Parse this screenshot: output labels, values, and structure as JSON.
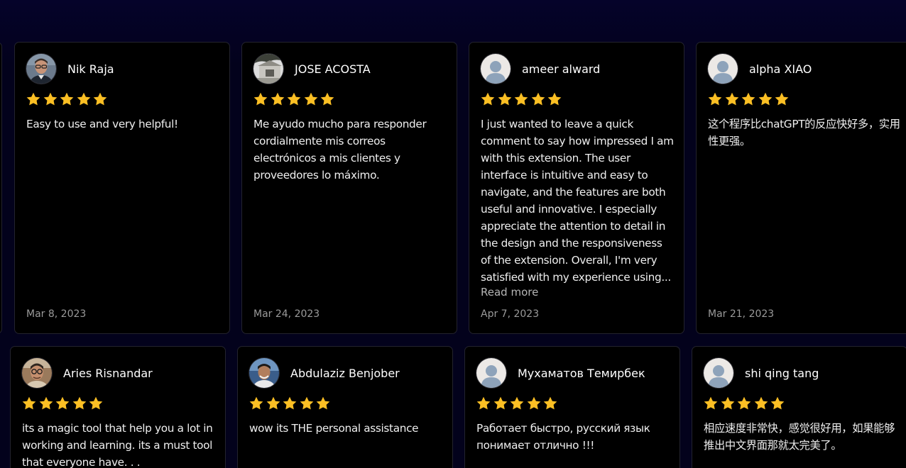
{
  "colors": {
    "background": "#03021c",
    "card": "#000000",
    "star": "#fbbf24",
    "text": "#eeeeee",
    "muted": "#9a9a9a"
  },
  "reviews": [
    {
      "name": "Nik Raja",
      "rating": 5,
      "text": "Easy to use and very helpful!",
      "date": "Mar 8, 2023",
      "avatar": "photo-man-glasses"
    },
    {
      "name": "JOSE ACOSTA",
      "rating": 5,
      "text": "Me ayudo mucho para responder cordialmente mis correos electrónicos a mis clientes y proveedores lo máximo.",
      "date": "Mar 24, 2023",
      "avatar": "photo-building"
    },
    {
      "name": "ameer alward",
      "rating": 5,
      "text": "I just wanted to leave a quick comment to say how impressed I am with this extension. The user interface is intuitive and easy to navigate, and the features are both useful and innovative. I especially appreciate the attention to detail in the design and the responsiveness of the extension. Overall, I'm very satisfied with my experience using...",
      "read_more": "Read more",
      "date": "Apr 7, 2023",
      "avatar": "default-user-avatar"
    },
    {
      "name": "alpha XIAO",
      "rating": 5,
      "text": "这个程序比chatGPT的反应快好多，实用性更强。",
      "date": "Mar 21, 2023",
      "avatar": "default-user-avatar"
    },
    {
      "name": "Aries Risnandar",
      "rating": 5,
      "text": "its a magic tool that help you a lot in working and learning. its a must tool that everyone have. . .",
      "avatar": "photo-man-round-glasses"
    },
    {
      "name": "Abdulaziz Benjober",
      "rating": 5,
      "text": "wow its THE personal assistance",
      "avatar": "photo-man-smiling"
    },
    {
      "name": "Мухаматов Темирбек",
      "rating": 5,
      "text": "Работает быстро, русский язык понимает отлично !!!",
      "avatar": "default-user-avatar"
    },
    {
      "name": "shi qing tang",
      "rating": 5,
      "text": "相应速度非常快，感觉很好用，如果能够推出中文界面那就太完美了。",
      "avatar": "default-user-avatar"
    }
  ]
}
